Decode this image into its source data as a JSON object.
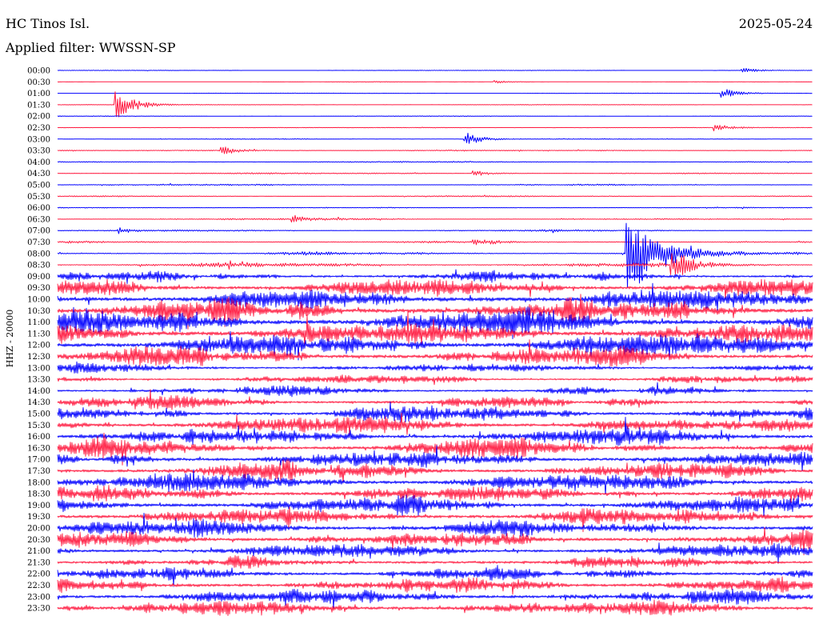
{
  "header": {
    "station": "HC Tinos Isl.",
    "date": "2025-05-24",
    "filter_text": "Applied filter: WWSSN-SP"
  },
  "chart_data": {
    "type": "line",
    "title": "HC Tinos Isl.",
    "subtitle": "Applied filter: WWSSN-SP",
    "date": "2025-05-24",
    "ylabel": "HHZ - 20000",
    "xlabel": "",
    "line_interval_minutes": 30,
    "grid": false,
    "colors": [
      "#0000ff",
      "#ff1a40"
    ],
    "y_tick_labels": [
      "00:00",
      "00:30",
      "01:00",
      "01:30",
      "02:00",
      "02:30",
      "03:00",
      "03:30",
      "04:00",
      "04:30",
      "05:00",
      "05:30",
      "06:00",
      "06:30",
      "07:00",
      "07:30",
      "08:00",
      "08:30",
      "09:00",
      "09:30",
      "10:00",
      "10:30",
      "11:00",
      "11:30",
      "12:00",
      "12:30",
      "13:00",
      "13:30",
      "14:00",
      "14:30",
      "15:00",
      "15:30",
      "16:00",
      "16:30",
      "17:00",
      "17:30",
      "18:00",
      "18:30",
      "19:00",
      "19:30",
      "20:00",
      "20:30",
      "21:00",
      "21:30",
      "22:00",
      "22:30",
      "23:00",
      "23:30"
    ],
    "noise_level": [
      0.04,
      0.03,
      0.04,
      0.05,
      0.05,
      0.05,
      0.06,
      0.12,
      0.1,
      0.11,
      0.12,
      0.11,
      0.12,
      0.13,
      0.14,
      0.18,
      0.25,
      0.35,
      0.9,
      1.4,
      1.8,
      2.0,
      2.0,
      1.9,
      1.8,
      1.6,
      0.75,
      0.7,
      0.8,
      1.05,
      1.2,
      1.35,
      1.45,
      1.4,
      1.4,
      1.35,
      1.45,
      1.4,
      1.45,
      1.45,
      1.45,
      1.4,
      1.15,
      1.1,
      1.2,
      1.3,
      1.35,
      1.35
    ],
    "events": [
      {
        "trace": "00:00",
        "minute": 27.3,
        "amplitude": 0.5
      },
      {
        "trace": "00:30",
        "minute": 17.5,
        "amplitude": 0.3
      },
      {
        "trace": "01:00",
        "minute": 26.5,
        "amplitude": 1.0
      },
      {
        "trace": "01:30",
        "minute": 2.4,
        "amplitude": 2.8
      },
      {
        "trace": "02:30",
        "minute": 26.2,
        "amplitude": 0.7
      },
      {
        "trace": "03:00",
        "minute": 16.3,
        "amplitude": 1.3
      },
      {
        "trace": "03:30",
        "minute": 6.6,
        "amplitude": 0.9
      },
      {
        "trace": "04:30",
        "minute": 16.6,
        "amplitude": 0.6
      },
      {
        "trace": "06:30",
        "minute": 9.4,
        "amplitude": 0.8
      },
      {
        "trace": "07:00",
        "minute": 2.5,
        "amplitude": 0.6
      },
      {
        "trace": "07:30",
        "minute": 16.6,
        "amplitude": 0.7
      },
      {
        "trace": "08:00",
        "minute": 22.7,
        "amplitude": 9.0
      },
      {
        "trace": "08:30",
        "minute": 24.5,
        "amplitude": 3.0
      }
    ]
  }
}
